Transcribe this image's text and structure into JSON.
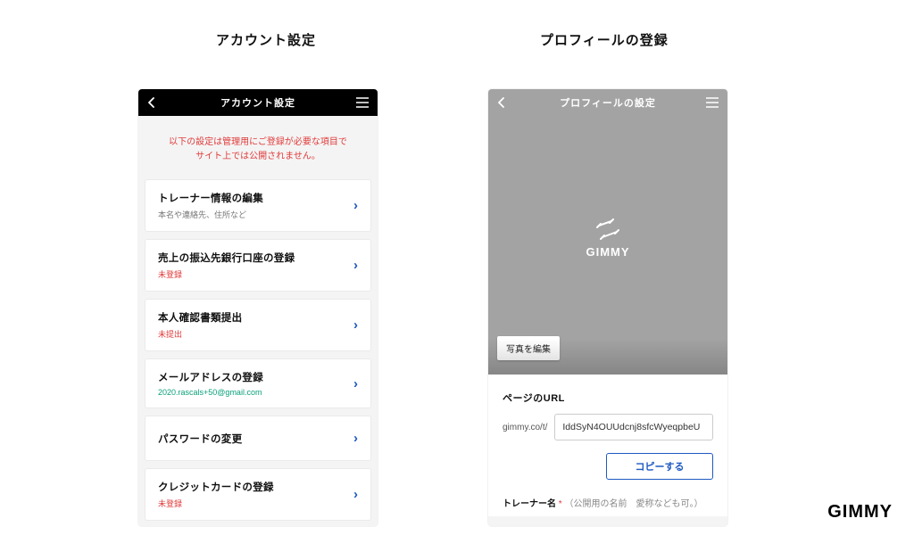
{
  "section_titles": {
    "left": "アカウント設定",
    "right": "プロフィールの登録"
  },
  "brand": "GIMMY",
  "left_screen": {
    "header_title": "アカウント設定",
    "notice_line1": "以下の設定は管理用にご登録が必要な項目で",
    "notice_line2": "サイト上では公開されません。",
    "items": [
      {
        "title": "トレーナー情報の編集",
        "sub": "本名や連絡先、住所など",
        "sub_style": "gray"
      },
      {
        "title": "売上の振込先銀行口座の登録",
        "sub": "未登録",
        "sub_style": "red"
      },
      {
        "title": "本人確認書類提出",
        "sub": "未提出",
        "sub_style": "red"
      },
      {
        "title": "メールアドレスの登録",
        "sub": "2020.rascals+50@gmail.com",
        "sub_style": "teal"
      },
      {
        "title": "パスワードの変更",
        "sub": "",
        "sub_style": "gray"
      },
      {
        "title": "クレジットカードの登録",
        "sub": "未登録",
        "sub_style": "red"
      }
    ]
  },
  "right_screen": {
    "header_title": "プロフィールの設定",
    "edit_photo_label": "写真を編集",
    "url_label": "ページのURL",
    "url_prefix": "gimmy.co/t/",
    "url_value": "IddSyN4OUUdcnj8sfcWyeqpbeU",
    "copy_label": "コピーする",
    "trainer_label": "トレーナー名",
    "trainer_required_mark": "*",
    "trainer_hint": "（公開用の名前　愛称なども可。）"
  }
}
